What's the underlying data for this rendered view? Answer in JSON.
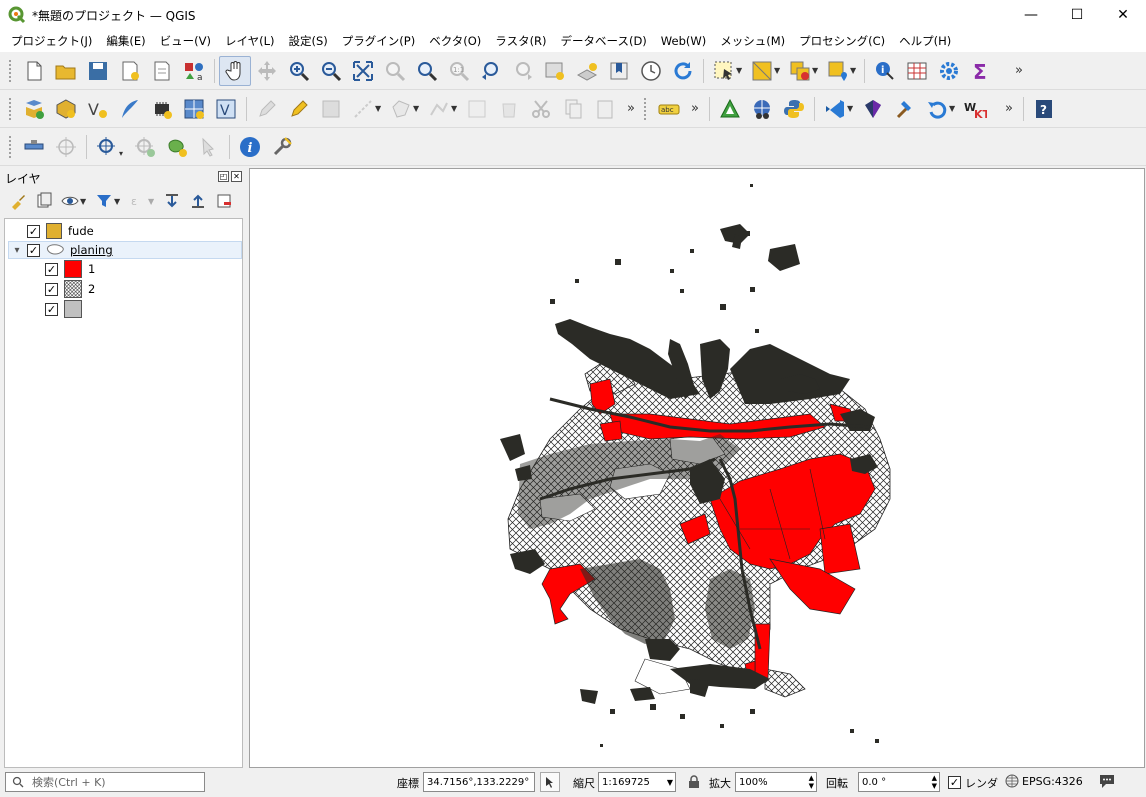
{
  "window": {
    "title": "*無題のプロジェクト — QGIS",
    "minimize": "—",
    "maximize": "☐",
    "close": "✕"
  },
  "menu": [
    "プロジェクト(J)",
    "編集(E)",
    "ビュー(V)",
    "レイヤ(L)",
    "設定(S)",
    "プラグイン(P)",
    "ベクタ(O)",
    "ラスタ(R)",
    "データベース(D)",
    "Web(W)",
    "メッシュ(M)",
    "プロセシング(C)",
    "ヘルプ(H)"
  ],
  "layers_panel": {
    "title": "レイヤ",
    "layers": [
      {
        "name": "fude",
        "checked": "✓",
        "color": "#e0b030"
      },
      {
        "name": "planing",
        "checked": "✓",
        "expand": "▾",
        "classes": [
          {
            "label": "1",
            "checked": "✓",
            "color": "#ff0000"
          },
          {
            "label": "2",
            "checked": "✓",
            "pattern": "crosshatch"
          },
          {
            "label": "",
            "checked": "✓",
            "color": "#c0c0c0"
          }
        ]
      }
    ]
  },
  "statusbar": {
    "search_placeholder": "検索(Ctrl + K)",
    "coord_label": "座標",
    "coord_value": "34.7156°,133.2229°",
    "scale_label": "縮尺",
    "scale_value": "1:169725",
    "magnify_label": "拡大",
    "magnify_value": "100%",
    "rotation_label": "回転",
    "rotation_value": "0.0 °",
    "render_label": "レンダ",
    "render_checked": "✓",
    "crs": "EPSG:4326"
  },
  "colors": {
    "accent": "#0078d7",
    "planning_red": "#ff0000",
    "land_dark": "#2b2b26"
  },
  "toolbar_more": "»"
}
